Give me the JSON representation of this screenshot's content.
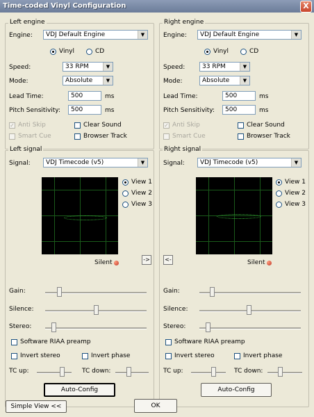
{
  "window": {
    "title": "Time-coded Vinyl Configuration",
    "close_label": "X"
  },
  "left_engine": {
    "group_label": "Left engine",
    "engine_label": "Engine:",
    "engine_value": "VDJ Default Engine",
    "vinyl_label": "Vinyl",
    "cd_label": "CD",
    "speed_label": "Speed:",
    "speed_value": "33 RPM",
    "mode_label": "Mode:",
    "mode_value": "Absolute",
    "lead_time_label": "Lead Time:",
    "lead_time_value": "500",
    "lead_time_unit": "ms",
    "pitch_label": "Pitch Sensitivity:",
    "pitch_value": "500",
    "pitch_unit": "ms",
    "anti_skip": "Anti Skip",
    "clear_sound": "Clear Sound",
    "smart_cue": "Smart Cue",
    "browser_track": "Browser Track"
  },
  "right_engine": {
    "group_label": "Right engine",
    "engine_label": "Engine:",
    "engine_value": "VDJ Default Engine",
    "vinyl_label": "Vinyl",
    "cd_label": "CD",
    "speed_label": "Speed:",
    "speed_value": "33 RPM",
    "mode_label": "Mode:",
    "mode_value": "Absolute",
    "lead_time_label": "Lead Time:",
    "lead_time_value": "500",
    "lead_time_unit": "ms",
    "pitch_label": "Pitch Sensitivity:",
    "pitch_value": "500",
    "pitch_unit": "ms",
    "anti_skip": "Anti Skip",
    "clear_sound": "Clear Sound",
    "smart_cue": "Smart Cue",
    "browser_track": "Browser Track"
  },
  "left_signal": {
    "group_label": "Left signal",
    "signal_label": "Signal:",
    "signal_value": "VDJ Timecode (v5)",
    "views": [
      "View 1",
      "View 2",
      "View 3"
    ],
    "silent_label": "Silent",
    "copy_button": "->",
    "gain_label": "Gain:",
    "silence_label": "Silence:",
    "stereo_label": "Stereo:",
    "riaa_label": "Software RIAA preamp",
    "invert_stereo": "Invert stereo",
    "invert_phase": "Invert phase",
    "tc_up": "TC up:",
    "tc_down": "TC down:",
    "auto_config": "Auto-Config"
  },
  "right_signal": {
    "group_label": "Right signal",
    "signal_label": "Signal:",
    "signal_value": "VDJ Timecode (v5)",
    "views": [
      "View 1",
      "View 2",
      "View 3"
    ],
    "silent_label": "Silent",
    "copy_button": "<-",
    "gain_label": "Gain:",
    "silence_label": "Silence:",
    "stereo_label": "Stereo:",
    "riaa_label": "Software RIAA preamp",
    "invert_stereo": "Invert stereo",
    "invert_phase": "Invert phase",
    "tc_up": "TC up:",
    "tc_down": "TC down:",
    "auto_config": "Auto-Config"
  },
  "footer": {
    "simple_view": "Simple View <<",
    "ok": "OK"
  }
}
